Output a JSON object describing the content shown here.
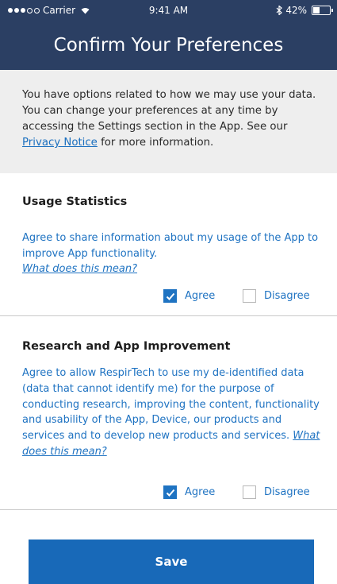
{
  "status_bar": {
    "carrier": "Carrier",
    "time": "9:41 AM",
    "battery": "42%",
    "battery_level": 0.42
  },
  "header": {
    "title": "Confirm Your Preferences"
  },
  "intro": {
    "text_before_link": "You have options related to how we may use your data.  You can change your preferences at any time by accessing the Settings section in the App.  See our ",
    "link": "Privacy Notice",
    "text_after_link": " for more information."
  },
  "usage": {
    "title": "Usage Statistics",
    "body": "Agree to share information about my usage of the App to improve App functionality.",
    "help_link": "What does this mean?",
    "agree_label": "Agree",
    "disagree_label": "Disagree",
    "agree_checked": true,
    "disagree_checked": false
  },
  "research": {
    "title": "Research and App Improvement",
    "body": "Agree to allow RespirTech to use my de-identified data (data that cannot identify me) for the purpose of conducting research, improving the content, functionality and usability of the App, Device, our products and services and to develop new products and services.",
    "help_link": "What does this mean?",
    "agree_label": "Agree",
    "disagree_label": "Disagree",
    "agree_checked": true,
    "disagree_checked": false
  },
  "save_label": "Save",
  "colors": {
    "header_bg": "#2b3f63",
    "accent": "#1f73c2",
    "button": "#1869b8",
    "intro_bg": "#eeeeee"
  }
}
